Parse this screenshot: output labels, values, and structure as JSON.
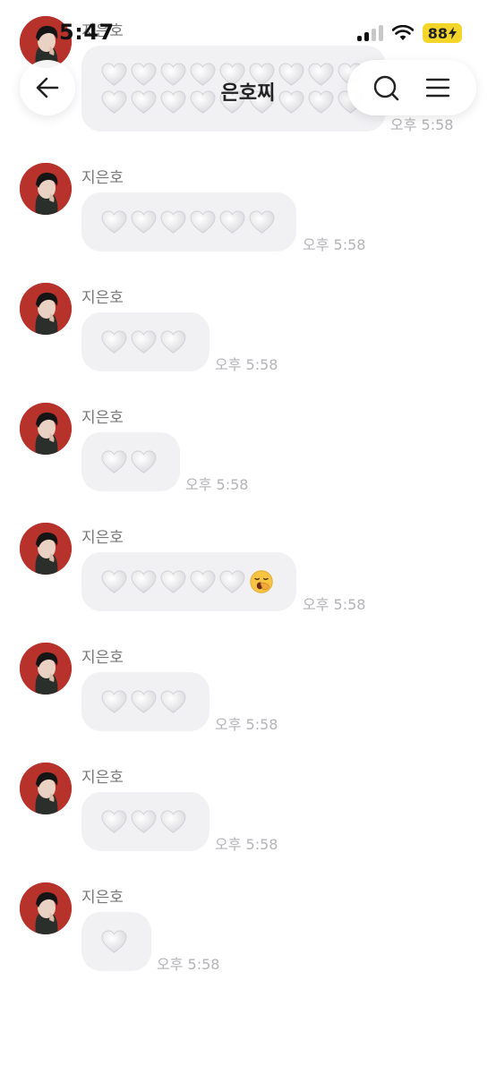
{
  "status_bar": {
    "time": "5:47",
    "battery": "88"
  },
  "header": {
    "title": "은호찌"
  },
  "messages": [
    {
      "sender": "지은호",
      "time": "오후 5:58",
      "content": "🤍🤍🤍🤍🤍🤍🤍🤍🤍🤍🤍🤍🤍🤍🤍🤍🤍🤍"
    },
    {
      "sender": "지은호",
      "time": "오후 5:58",
      "content": "🤍🤍🤍🤍🤍🤍"
    },
    {
      "sender": "지은호",
      "time": "오후 5:58",
      "content": "🤍🤍🤍"
    },
    {
      "sender": "지은호",
      "time": "오후 5:58",
      "content": "🤍🤍"
    },
    {
      "sender": "지은호",
      "time": "오후 5:58",
      "content": "🤍🤍🤍🤍🤍🥱"
    },
    {
      "sender": "지은호",
      "time": "오후 5:58",
      "content": "🤍🤍🤍"
    },
    {
      "sender": "지은호",
      "time": "오후 5:58",
      "content": "🤍🤍🤍"
    },
    {
      "sender": "지은호",
      "time": "오후 5:58",
      "content": "🤍"
    }
  ],
  "icons": {
    "back": "arrow-left-icon",
    "search": "search-icon",
    "menu": "hamburger-menu-icon",
    "heart": "white-heart-emoji",
    "yawn": "yawning-face-emoji"
  },
  "colors": {
    "bubble": "#f1f1f4",
    "time_text": "#b3b3b8",
    "battery": "#f4d52a",
    "avatar_bg": "#b8322c"
  }
}
